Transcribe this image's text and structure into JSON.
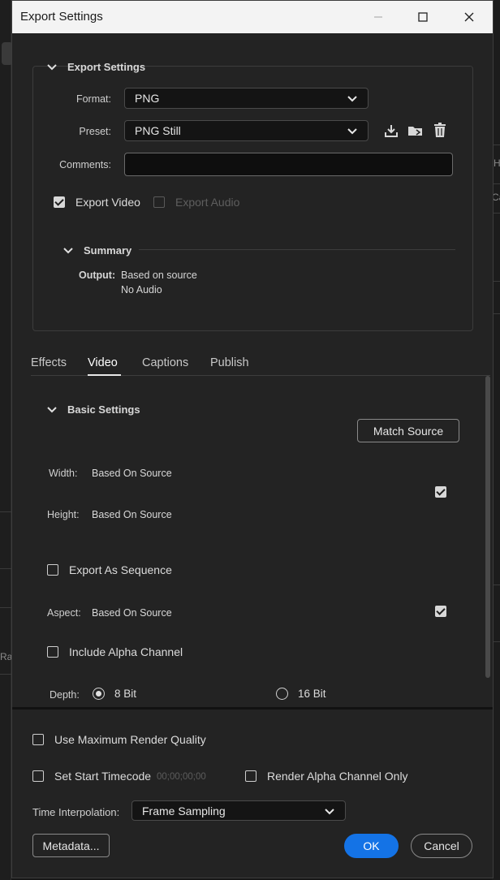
{
  "window": {
    "title": "Export Settings",
    "minimize_glyph": "—",
    "maximize_glyph": "☐",
    "close_glyph": "✕"
  },
  "background": {
    "right_frag_1": "H",
    "right_frag_2": "Ca",
    "left_frag_1": "Ra"
  },
  "export_settings": {
    "heading": "Export Settings",
    "format_label": "Format:",
    "format_value": "PNG",
    "preset_label": "Preset:",
    "preset_value": "PNG Still",
    "comments_label": "Comments:",
    "comments_value": "",
    "export_video_label": "Export Video",
    "export_video_checked": true,
    "export_audio_label": "Export Audio",
    "export_audio_checked": false,
    "preset_icons": [
      "import-preset-icon",
      "folder-icon",
      "trash-icon"
    ]
  },
  "summary": {
    "heading": "Summary",
    "output_label": "Output:",
    "output_line1": "Based on source",
    "output_line2": "No Audio"
  },
  "tabs": [
    {
      "label": "Effects",
      "active": false
    },
    {
      "label": "Video",
      "active": true
    },
    {
      "label": "Captions",
      "active": false
    },
    {
      "label": "Publish",
      "active": false
    }
  ],
  "video": {
    "basic_settings_heading": "Basic Settings",
    "match_source_label": "Match Source",
    "width_label": "Width:",
    "width_value": "Based On Source",
    "height_label": "Height:",
    "height_value": "Based On Source",
    "link_dimensions_checked": true,
    "export_sequence_label": "Export As Sequence",
    "export_sequence_checked": false,
    "aspect_label": "Aspect:",
    "aspect_value": "Based On Source",
    "aspect_checked": true,
    "alpha_channel_label": "Include Alpha Channel",
    "alpha_channel_checked": false,
    "depth_label": "Depth:",
    "depth_options": [
      {
        "label": "8 Bit",
        "selected": true
      },
      {
        "label": "16 Bit",
        "selected": false
      }
    ]
  },
  "bottom": {
    "max_render_quality_label": "Use Maximum Render Quality",
    "max_render_quality_checked": false,
    "start_timecode_label": "Set Start Timecode",
    "start_timecode_checked": false,
    "start_timecode_value": "00;00;00;00",
    "render_alpha_only_label": "Render Alpha Channel Only",
    "render_alpha_only_checked": false,
    "time_interp_label": "Time Interpolation:",
    "time_interp_value": "Frame Sampling",
    "metadata_button": "Metadata...",
    "ok_button": "OK",
    "cancel_button": "Cancel"
  },
  "colors": {
    "accent": "#1473e6",
    "dialog_bg": "#232323",
    "titlebar_bg": "#f3f3f3"
  }
}
